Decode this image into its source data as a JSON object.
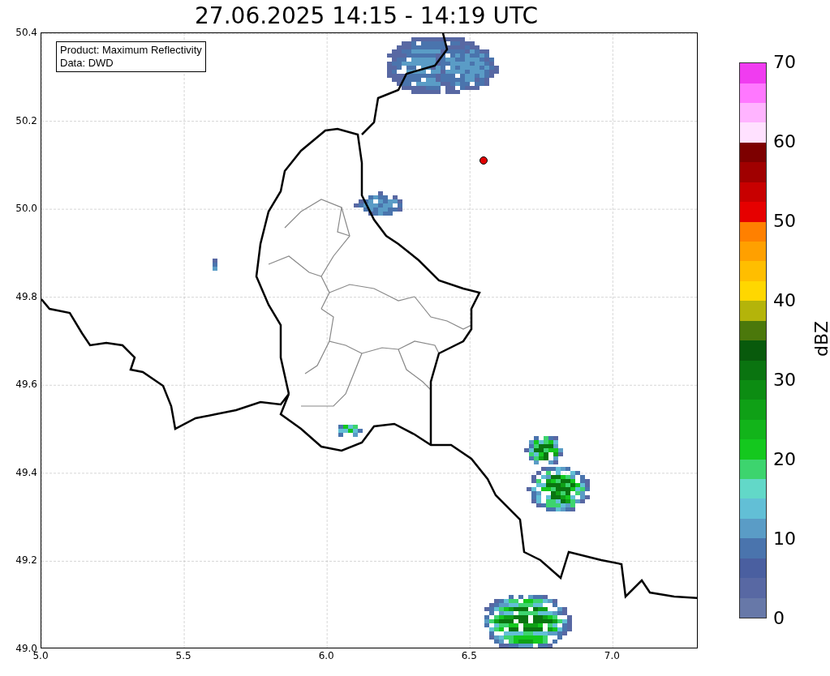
{
  "title": "27.06.2025 14:15 - 14:19 UTC",
  "info_box": [
    "Product: Maximum Reflectivity",
    "Data: DWD"
  ],
  "map": {
    "y_ticks": [
      "50.4",
      "50.2",
      "50.0",
      "49.8",
      "49.6",
      "49.4",
      "49.2",
      "49.0"
    ],
    "x_ticks": [
      "5.0",
      "5.5",
      "6.0",
      "6.5",
      "7.0"
    ],
    "marker": {
      "color": "#e00000"
    }
  },
  "colorbar": {
    "label": "dBZ",
    "ticks": [
      "70",
      "60",
      "50",
      "40",
      "30",
      "20",
      "10",
      "0"
    ],
    "segments": [
      {
        "color": "#6778a8"
      },
      {
        "color": "#5868a3"
      },
      {
        "color": "#4a5fa0"
      },
      {
        "color": "#4a74ad"
      },
      {
        "color": "#5a9cc6"
      },
      {
        "color": "#62bfd6"
      },
      {
        "color": "#62d8c8"
      },
      {
        "color": "#3dd46e"
      },
      {
        "color": "#14c81e"
      },
      {
        "color": "#12b41a"
      },
      {
        "color": "#0fa016"
      },
      {
        "color": "#0c8c12"
      },
      {
        "color": "#0a7410"
      },
      {
        "color": "#085a0c"
      },
      {
        "color": "#4b780b"
      },
      {
        "color": "#b4b40a"
      },
      {
        "color": "#ffd700"
      },
      {
        "color": "#ffbe00"
      },
      {
        "color": "#ffa000"
      },
      {
        "color": "#ff8000"
      },
      {
        "color": "#e60000"
      },
      {
        "color": "#c80000"
      },
      {
        "color": "#a00000"
      },
      {
        "color": "#7d0000"
      },
      {
        "color": "#ffe1ff"
      },
      {
        "color": "#ffb4ff"
      },
      {
        "color": "#ff78ff"
      },
      {
        "color": "#f03cf0"
      }
    ]
  }
}
